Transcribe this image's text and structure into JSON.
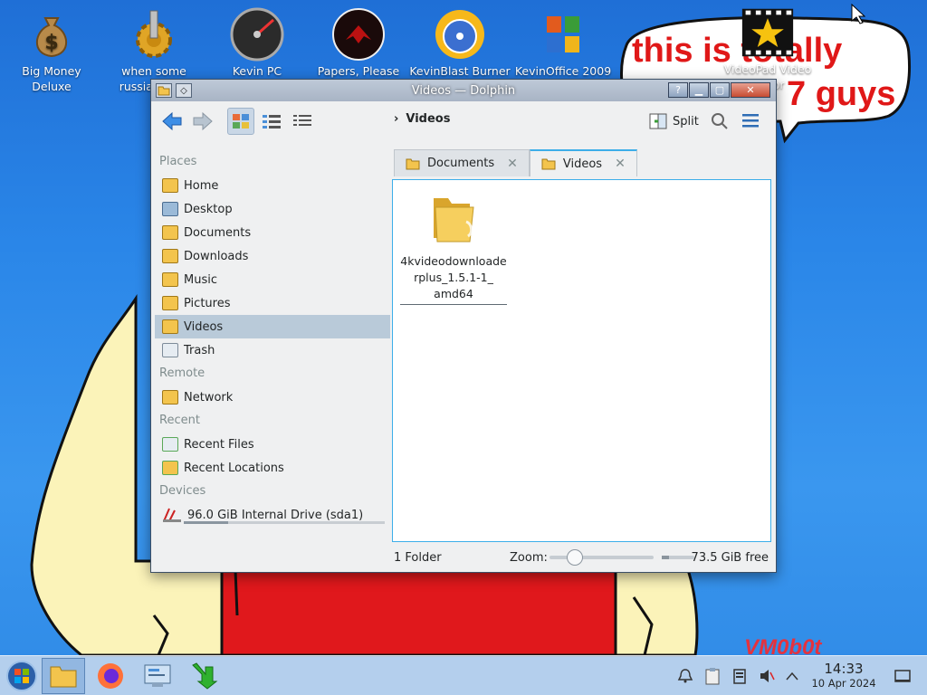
{
  "desktop": {
    "icons": [
      {
        "label": "Big Money Deluxe",
        "icon": "money-bag-icon"
      },
      {
        "label": "when some russian ha...",
        "icon": "golden-gear-icon"
      },
      {
        "label": "Kevin PC Optimizer Ho...",
        "icon": "speedometer-icon"
      },
      {
        "label": "Papers, Please",
        "icon": "red-emblem-icon"
      },
      {
        "label": "KevinBlast Burner",
        "icon": "burning-disc-icon"
      },
      {
        "label": "KevinOffice 2009",
        "icon": "office-logo-icon"
      },
      {
        "label": "VideoPad Video Editor",
        "icon": "film-star-icon"
      }
    ],
    "speech_text": "this is totally windows 7 guys",
    "watermark": "VM0b0t"
  },
  "window": {
    "title": "Videos — Dolphin",
    "breadcrumb": "Videos",
    "split_label": "Split",
    "places": [
      {
        "type": "section",
        "label": "Places"
      },
      {
        "type": "item",
        "label": "Home",
        "icon": "home-folder-icon"
      },
      {
        "type": "item",
        "label": "Desktop",
        "icon": "desktop-folder-icon"
      },
      {
        "type": "item",
        "label": "Documents",
        "icon": "documents-folder-icon"
      },
      {
        "type": "item",
        "label": "Downloads",
        "icon": "downloads-folder-icon"
      },
      {
        "type": "item",
        "label": "Music",
        "icon": "music-folder-icon"
      },
      {
        "type": "item",
        "label": "Pictures",
        "icon": "pictures-folder-icon"
      },
      {
        "type": "item",
        "label": "Videos",
        "icon": "videos-folder-icon",
        "selected": true
      },
      {
        "type": "item",
        "label": "Trash",
        "icon": "trash-icon"
      },
      {
        "type": "section",
        "label": "Remote"
      },
      {
        "type": "item",
        "label": "Network",
        "icon": "network-icon"
      },
      {
        "type": "section",
        "label": "Recent"
      },
      {
        "type": "item",
        "label": "Recent Files",
        "icon": "recent-files-icon"
      },
      {
        "type": "item",
        "label": "Recent Locations",
        "icon": "recent-locations-icon"
      },
      {
        "type": "section",
        "label": "Devices"
      },
      {
        "type": "item",
        "label": "96.0 GiB Internal Drive (sda1)",
        "icon": "drive-icon",
        "usage_fraction": 0.22
      }
    ],
    "tabs": [
      {
        "label": "Documents",
        "active": false
      },
      {
        "label": "Videos",
        "active": true
      }
    ],
    "files": [
      {
        "name": "4kvideodownloaderplus_1.5.1-1_amd64",
        "lines": [
          "4kvideodownloade",
          "rplus_1.5.1-1_",
          "amd64"
        ],
        "icon": "folder-icon"
      }
    ],
    "status": {
      "count": "1 Folder",
      "zoom_label": "Zoom:",
      "zoom_level": 0.2,
      "free_space": "73.5 GiB free",
      "free_fraction": 0.23
    }
  },
  "taskbar": {
    "apps": [
      {
        "name": "start-button",
        "icon": "windows-orb-icon"
      },
      {
        "name": "dolphin",
        "icon": "folder-icon",
        "active": true
      },
      {
        "name": "firefox",
        "icon": "firefox-icon"
      },
      {
        "name": "settings",
        "icon": "system-settings-icon"
      },
      {
        "name": "download",
        "icon": "green-arrow-icon"
      }
    ],
    "clock": {
      "time": "14:33",
      "date": "10 Apr 2024"
    }
  }
}
